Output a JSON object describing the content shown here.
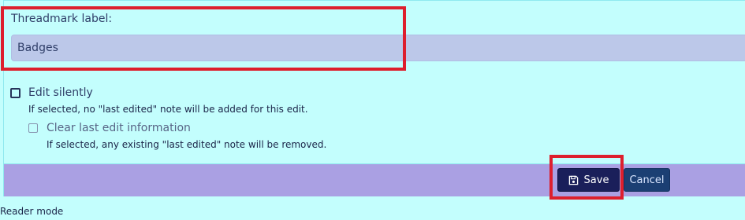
{
  "form": {
    "threadmark_label": {
      "label": "Threadmark label:",
      "value": "Badges"
    },
    "edit_silently": {
      "label": "Edit silently",
      "checked": false,
      "hint": "If selected, no \"last edited\" note will be added for this edit."
    },
    "clear_last_edit": {
      "label": "Clear last edit information",
      "checked": false,
      "hint": "If selected, any existing \"last edited\" note will be removed."
    }
  },
  "footer": {
    "save_label": "Save",
    "save_icon": "floppy-disk-icon",
    "cancel_label": "Cancel"
  },
  "reader_mode": "Reader mode",
  "colors": {
    "background": "#c3fefd",
    "footer_bar": "#aaa0e3",
    "save_button": "#1a1f5a",
    "cancel_button": "#1b3f73",
    "highlight": "#dd1f2d"
  }
}
